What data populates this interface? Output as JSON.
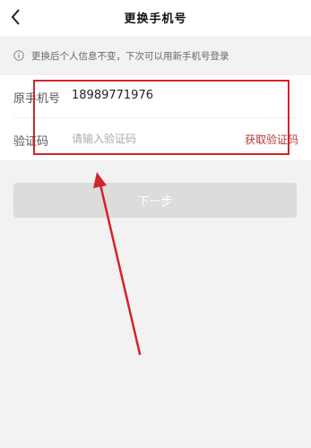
{
  "header": {
    "title": "更换手机号",
    "back_icon": "chevron-left-icon"
  },
  "notice": {
    "icon": "info-icon",
    "text": "更换后个人信息不变，下次可以用新手机号登录"
  },
  "form": {
    "original_phone": {
      "label": "原手机号",
      "value": "18989771976"
    },
    "verification_code": {
      "label": "验证码",
      "placeholder": "请输入验证码",
      "value": "",
      "get_code_label": "获取验证码"
    }
  },
  "next_button": {
    "label": "下一步"
  },
  "annotation": {
    "color": "#d2242b"
  },
  "colors": {
    "accent": "#b33a3a",
    "background": "#f2f2f2",
    "button_disabled": "#dcdcdc"
  }
}
